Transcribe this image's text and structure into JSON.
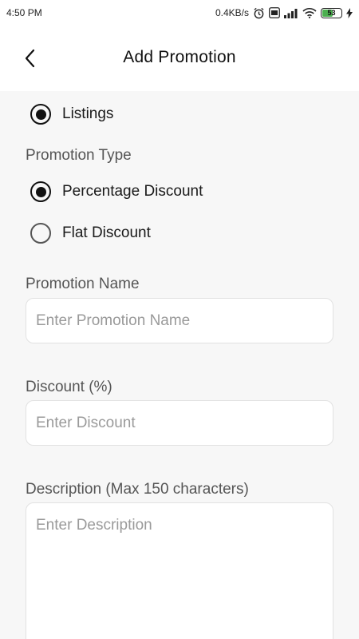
{
  "status_bar": {
    "time": "4:50 PM",
    "network_speed": "0.4KB/s",
    "battery_level": "53",
    "battery_fraction": 0.53,
    "icons": [
      "alarm-icon",
      "volte-icon",
      "signal-icon",
      "wifi-icon",
      "battery-icon",
      "charging-icon"
    ]
  },
  "header": {
    "title": "Add Promotion",
    "back_icon": "chevron-left-icon"
  },
  "form": {
    "listings_option": {
      "label": "Listings",
      "selected": true
    },
    "promotion_type": {
      "label": "Promotion Type",
      "options": [
        {
          "label": "Percentage Discount",
          "selected": true
        },
        {
          "label": "Flat Discount",
          "selected": false
        }
      ]
    },
    "promotion_name": {
      "label": "Promotion Name",
      "placeholder": "Enter Promotion Name",
      "value": ""
    },
    "discount": {
      "label": "Discount (%)",
      "placeholder": "Enter Discount",
      "value": ""
    },
    "description": {
      "label": "Description (Max 150 characters)",
      "placeholder": "Enter Description",
      "value": ""
    }
  },
  "colors": {
    "background": "#f7f7f7",
    "surface": "#ffffff",
    "text": "#1a1a1a",
    "muted_label": "#555555",
    "placeholder": "#9a9a9a",
    "battery_green": "#4caf50"
  }
}
